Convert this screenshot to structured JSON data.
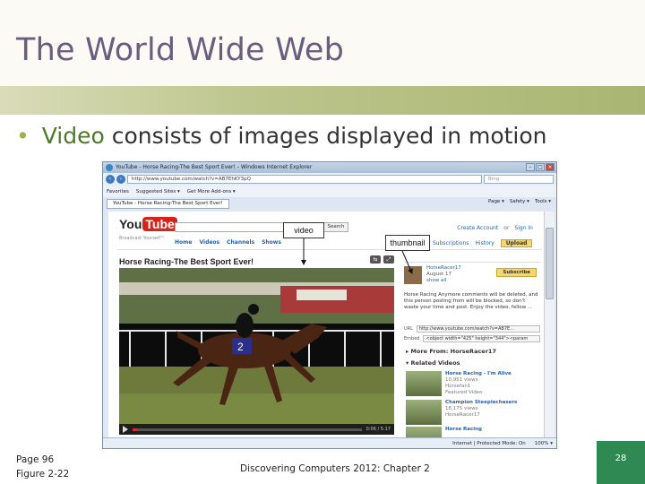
{
  "slide": {
    "title": "The World Wide Web",
    "bullet_keyword": "Video",
    "bullet_rest": " consists of images displayed in motion"
  },
  "browser": {
    "window_title": "YouTube - Horse Racing-The Best Sport Ever! - Windows Internet Explorer",
    "address": "http://www.youtube.com/watch?v=AB7EhKY3pQ",
    "search_placeholder": "Bing",
    "favorites_label": "Favorites",
    "favorites_items": [
      "Suggested Sites ▾",
      "Get More Add-ons ▾"
    ],
    "tab_label": "YouTube - Horse Racing-The Best Sport Ever!",
    "command_items": [
      "Page ▾",
      "Safety ▾",
      "Tools ▾"
    ],
    "status_items": [
      "Internet | Protected Mode: On",
      "100% ▾"
    ]
  },
  "youtube": {
    "logo_you": "You",
    "logo_tube": "Tube",
    "tagline": "Broadcast Yourself™",
    "search_button": "Search",
    "nav": [
      "Home",
      "Videos",
      "Channels",
      "Shows"
    ],
    "account": [
      "Create Account",
      "or",
      "Sign In"
    ],
    "right_nav": [
      "Subscriptions",
      "History"
    ],
    "upload_label": "Upload",
    "video_title": "Horse Racing-The Best Sport Ever!",
    "video_time": "0:06 / 5:17",
    "uploader_name": "HorseRacer17",
    "upload_date": "August 17",
    "show_more": "show all",
    "subscribe_label": "Subscribe",
    "description": "Horse Racing Anymore comments will be deleted, and this person posting from will be blocked, so don't waste your time and post. Enjoy the video, fellow ...",
    "url_label": "URL",
    "url_value": "http://www.youtube.com/watch?v=AB7E...",
    "embed_label": "Embed",
    "embed_value": "<object width=\"425\" height=\"344\"><param",
    "more_from": "More From: HorseRacer17",
    "related_head": "Related Videos",
    "related": [
      {
        "title": "Horse Racing - I'm Alive",
        "views": "10,951 views",
        "user": "Horsefan1",
        "featured": "Featured Video"
      },
      {
        "title": "Champion Steeplechasers",
        "views": "18,175 views",
        "user": "HorseRacer17",
        "featured": ""
      },
      {
        "title": "Horse Racing",
        "views": "",
        "user": "",
        "featured": ""
      }
    ],
    "saddle_number": "2"
  },
  "video_progress": 0.02,
  "callouts": {
    "video": "video",
    "thumbnail": "thumbnail"
  },
  "footer": {
    "page": "Page 96",
    "figure": "Figure 2-22",
    "course": "Discovering Computers 2012: Chapter 2",
    "slide_number": "28"
  },
  "colors": {
    "title": "#6b5d7e",
    "bullet_dot": "#9db24a",
    "keyword": "#4d7a2a",
    "badge": "#2e8a52"
  }
}
